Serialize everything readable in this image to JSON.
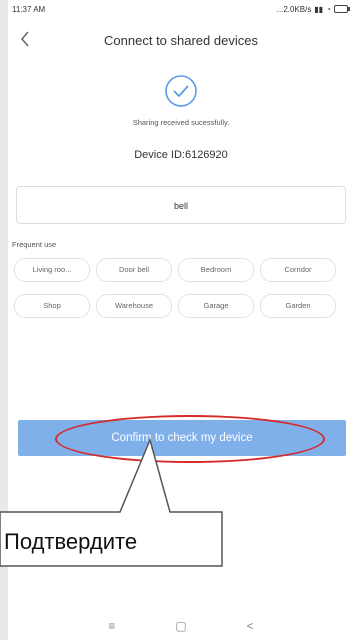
{
  "status": {
    "time": "11:37 AM",
    "speed": "...2.0KB/s"
  },
  "header": {
    "title": "Connect to shared devices"
  },
  "success": {
    "message": "Sharing received sucessfully.",
    "device_id": "Device ID:6126920"
  },
  "name_input": {
    "value": "bell"
  },
  "frequent": {
    "label": "Frequent use",
    "chips": [
      "Living roo...",
      "Door bell",
      "Bedroom",
      "Corridor",
      "Shop",
      "Warehouse",
      "Garage",
      "Garden"
    ]
  },
  "confirm_button": {
    "label": "Confirm to check my device"
  },
  "annotation": {
    "callout_text": "Подтвердите",
    "highlight_color": "#d62a2a"
  },
  "nav": {
    "menu": "≡",
    "home": "▢",
    "back": "<"
  },
  "colors": {
    "accent": "#7fb0ea",
    "check": "#5b9be6"
  }
}
